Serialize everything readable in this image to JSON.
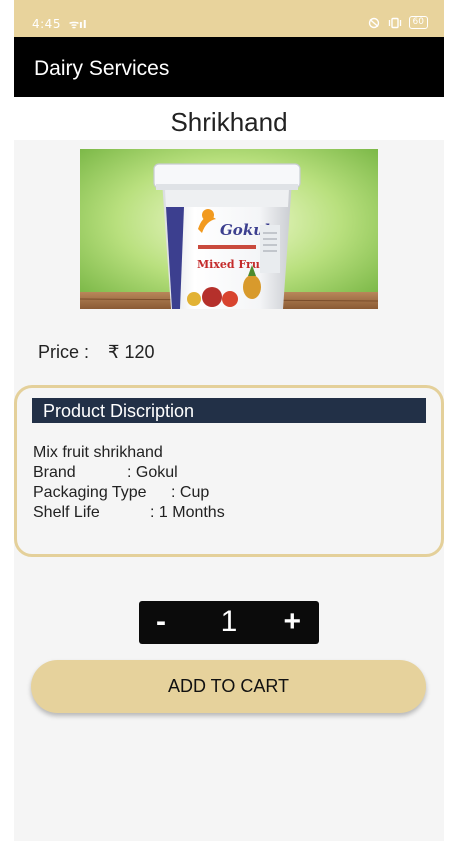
{
  "status_bar": {
    "time": "4:45",
    "signal_text": "ᯤıl",
    "battery": "60"
  },
  "app_bar": {
    "title": "Dairy Services"
  },
  "product": {
    "name": "Shrikhand",
    "image_brand_text": "Gokul",
    "image_variant_text": "Mixed Fruit",
    "price_label": "Price :",
    "price_value": "₹ 120"
  },
  "description": {
    "header": "Product Discription",
    "summary": "Mix fruit shrikhand",
    "brand_label": "Brand",
    "brand_value": ": Gokul",
    "packaging_label": "Packaging Type",
    "packaging_value": ": Cup",
    "shelf_label": "Shelf Life",
    "shelf_value": ": 1 Months"
  },
  "quantity": {
    "minus": "-",
    "value": "1",
    "plus": "+"
  },
  "cart": {
    "button_label": "ADD TO CART"
  },
  "colors": {
    "status_bar": "#e8d39c",
    "app_bar": "#000000",
    "description_header": "#223047",
    "card_border": "#e4d09a",
    "cart_button": "#e6d29c"
  }
}
